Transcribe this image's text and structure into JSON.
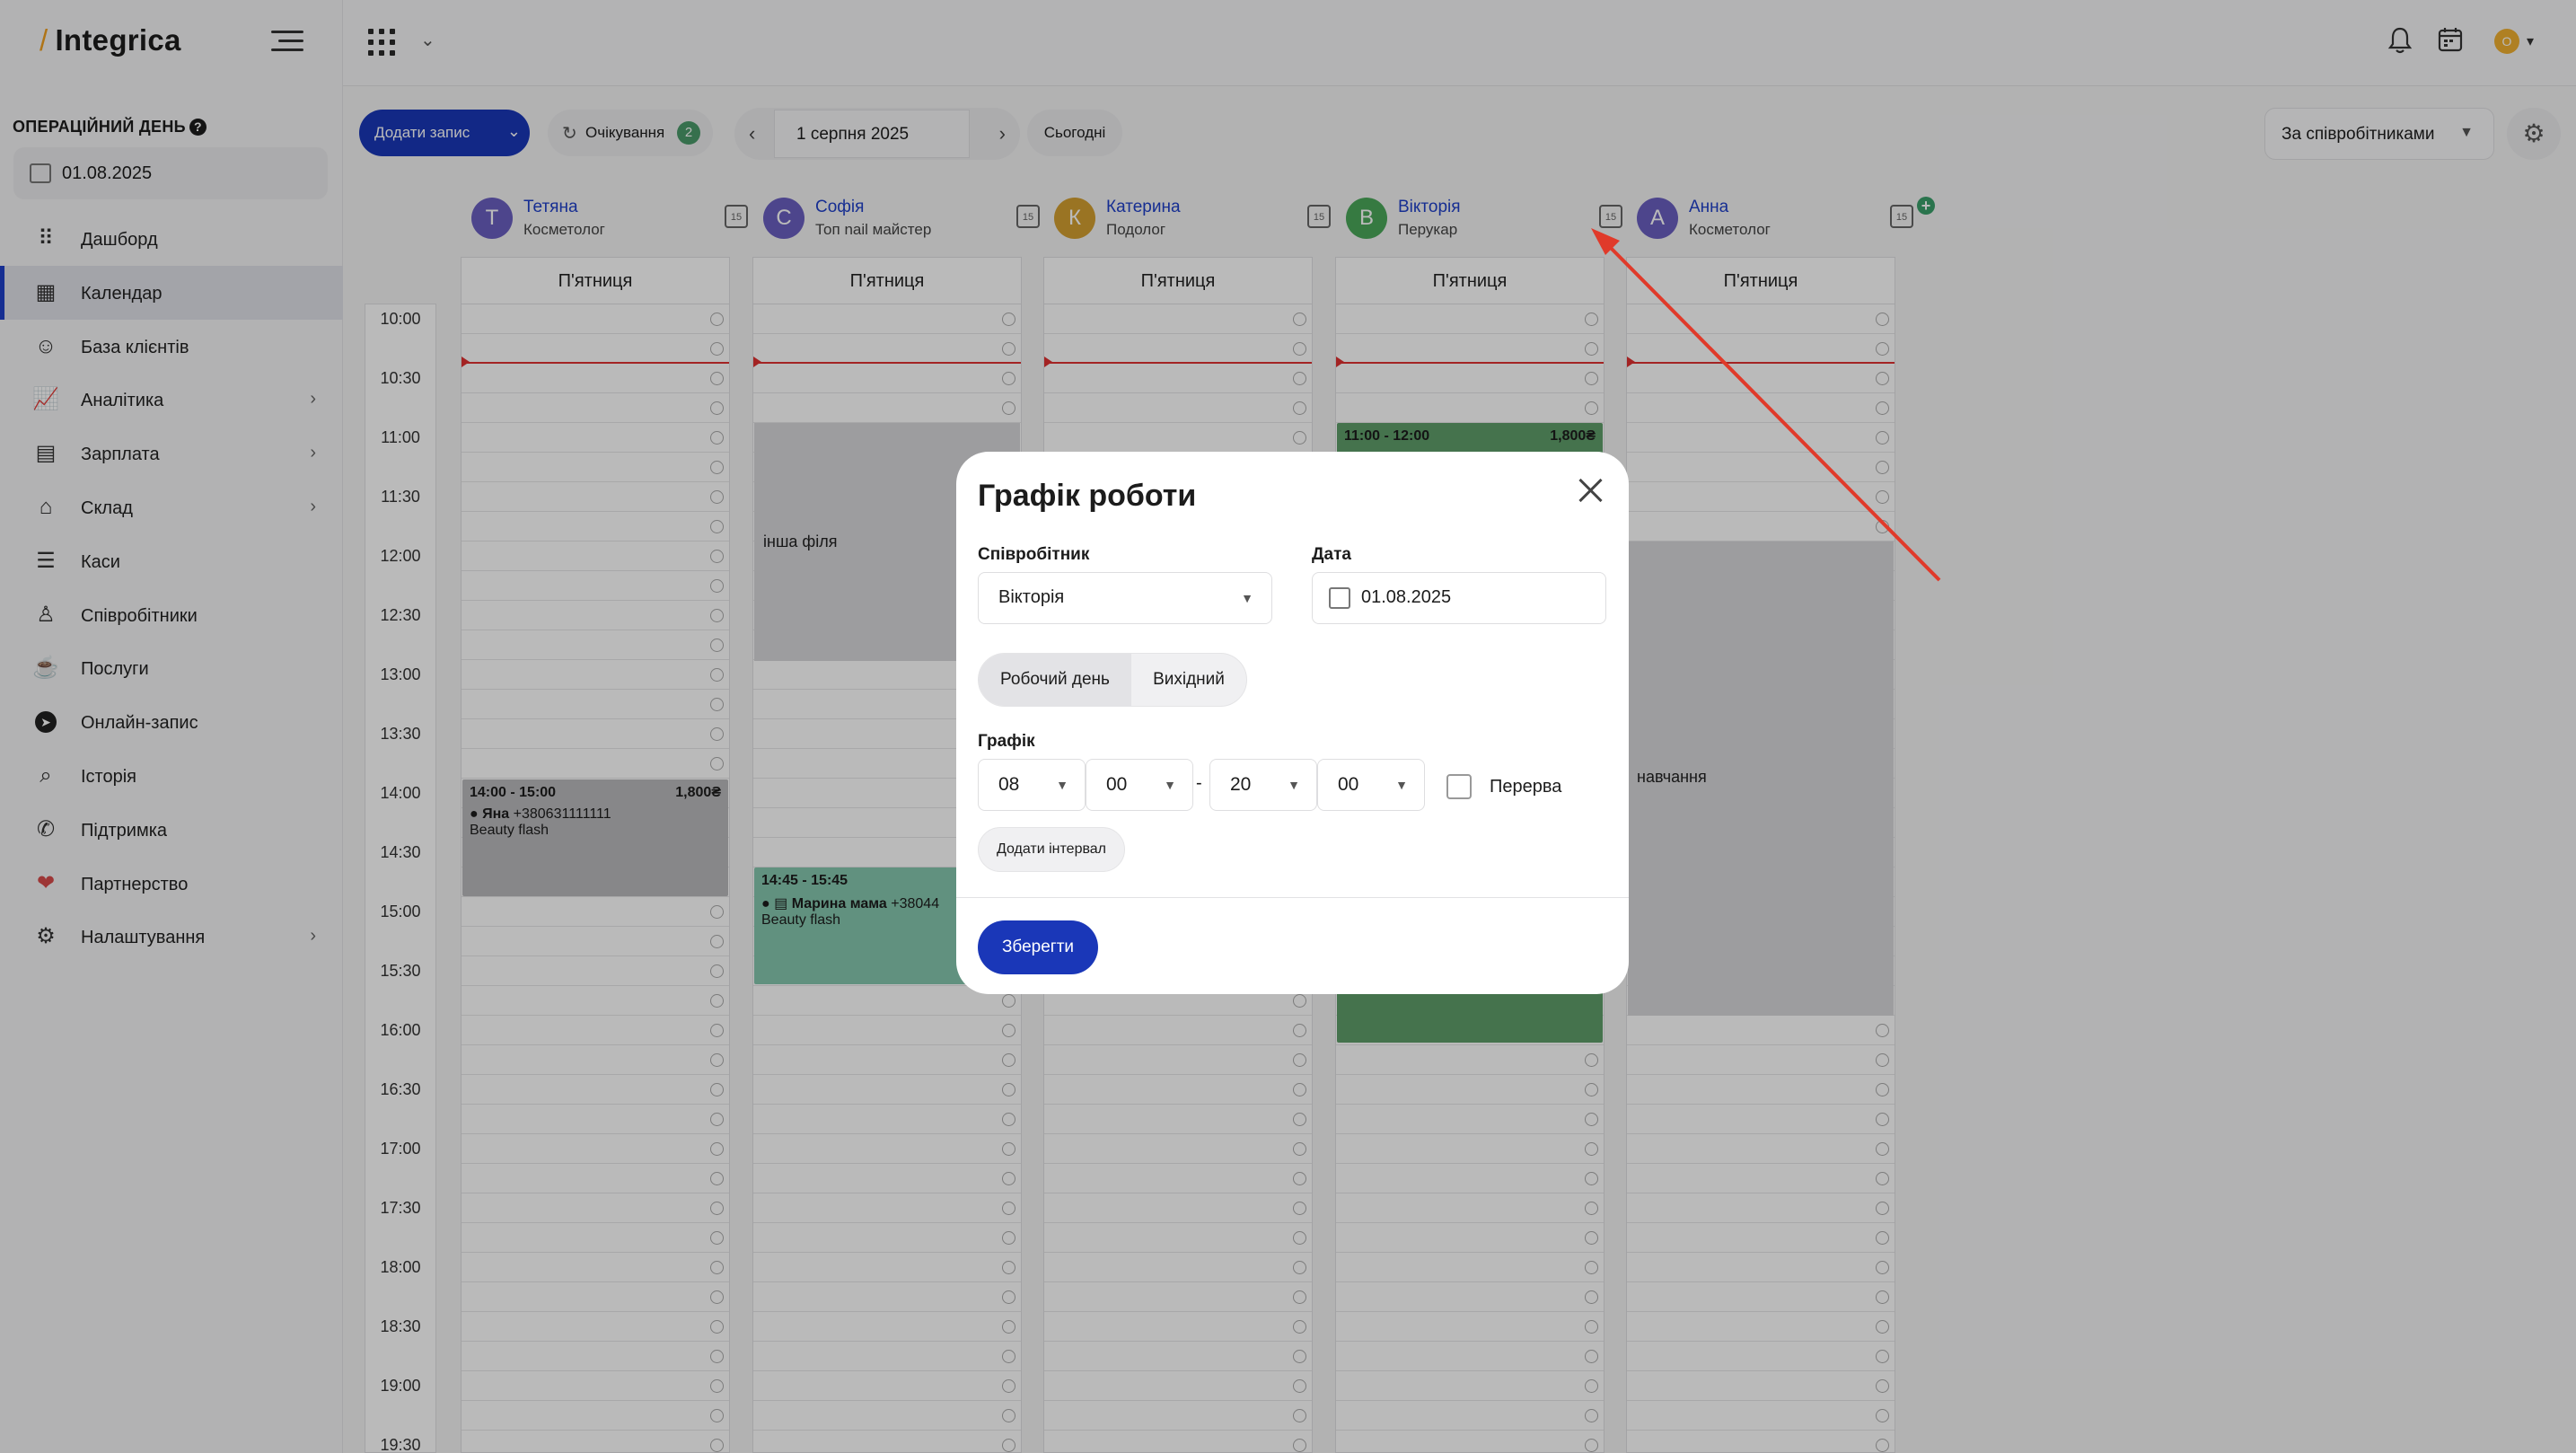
{
  "sidebar": {
    "logo": "Integrica",
    "op_day_label": "ОПЕРАЦІЙНИЙ ДЕНЬ",
    "op_day_date": "01.08.2025",
    "items": [
      {
        "label": "Дашборд",
        "icon": "dashboard-icon"
      },
      {
        "label": "Календар",
        "icon": "calendar-icon",
        "active": true
      },
      {
        "label": "База клієнтів",
        "icon": "clients-icon"
      },
      {
        "label": "Аналітика",
        "icon": "analytics-icon",
        "chevron": true
      },
      {
        "label": "Зарплата",
        "icon": "salary-icon",
        "chevron": true
      },
      {
        "label": "Склад",
        "icon": "warehouse-icon",
        "chevron": true
      },
      {
        "label": "Каси",
        "icon": "cash-icon"
      },
      {
        "label": "Співробітники",
        "icon": "staff-icon"
      },
      {
        "label": "Послуги",
        "icon": "services-icon"
      },
      {
        "label": "Онлайн-запис",
        "icon": "telegram-icon"
      },
      {
        "label": "Історія",
        "icon": "search-icon"
      },
      {
        "label": "Підтримка",
        "icon": "support-icon"
      },
      {
        "label": "Партнерство",
        "icon": "heart-icon"
      },
      {
        "label": "Налаштування",
        "icon": "gear-icon",
        "chevron": true
      }
    ]
  },
  "toolbar": {
    "add_label": "Додати запис",
    "waiting_label": "Очікування",
    "waiting_count": "2",
    "date": "1 серпня 2025",
    "today_label": "Сьогодні",
    "view_select": "За співробітниками"
  },
  "user": {
    "avatar_letter": "О"
  },
  "calendar": {
    "day_name": "П'ятниця",
    "times": [
      "10:00",
      "10:30",
      "11:00",
      "11:30",
      "12:00",
      "12:30",
      "13:00",
      "13:30",
      "14:00",
      "14:30",
      "15:00",
      "15:30",
      "16:00",
      "16:30",
      "17:00",
      "17:30",
      "18:00",
      "18:30",
      "19:00",
      "19:30"
    ],
    "staff": [
      {
        "initial": "Т",
        "name": "Тетяна",
        "role": "Косметолог",
        "color": "#6a5fc1"
      },
      {
        "initial": "С",
        "name": "Софія",
        "role": "Топ nail майстер",
        "color": "#6a5fc1"
      },
      {
        "initial": "К",
        "name": "Катерина",
        "role": "Подолог",
        "color": "#d4a030"
      },
      {
        "initial": "В",
        "name": "Вікторія",
        "role": "Перукар",
        "color": "#4aa85a"
      },
      {
        "initial": "А",
        "name": "Анна",
        "role": "Косметолог",
        "color": "#6a5fc1"
      }
    ],
    "calendar_icon_text": "15",
    "events": {
      "tetiana": {
        "time": "14:00 - 15:00",
        "price": "1,800₴",
        "client": "Яна",
        "phone": "+380631111111",
        "service": "Beauty flash"
      },
      "sofia": {
        "time": "14:45 - 15:45",
        "client": "Марина мама",
        "phone": "+38044",
        "service": "Beauty flash"
      },
      "viktoria": {
        "time": "11:00 - 12:00",
        "price": "1,800₴"
      }
    },
    "blocks": {
      "sofia": "інша філя",
      "anna": "навчання"
    }
  },
  "modal": {
    "title": "Графік роботи",
    "employee_label": "Співробітник",
    "employee_value": "Вікторія",
    "date_label": "Дата",
    "date_value": "01.08.2025",
    "work_day": "Робочий день",
    "day_off": "Вихідний",
    "schedule_label": "Графік",
    "start_hour": "08",
    "start_min": "00",
    "end_hour": "20",
    "end_min": "00",
    "dash": "-",
    "break_label": "Перерва",
    "add_interval": "Додати інтервал",
    "save": "Зберегти"
  },
  "colors": {
    "accent": "#1a37b8",
    "event_grey": "#b9b9bc",
    "event_teal": "#86c7ae",
    "event_green": "#5f9e6a",
    "now_line": "#e03030",
    "annotation_arrow": "#e03a2a"
  }
}
